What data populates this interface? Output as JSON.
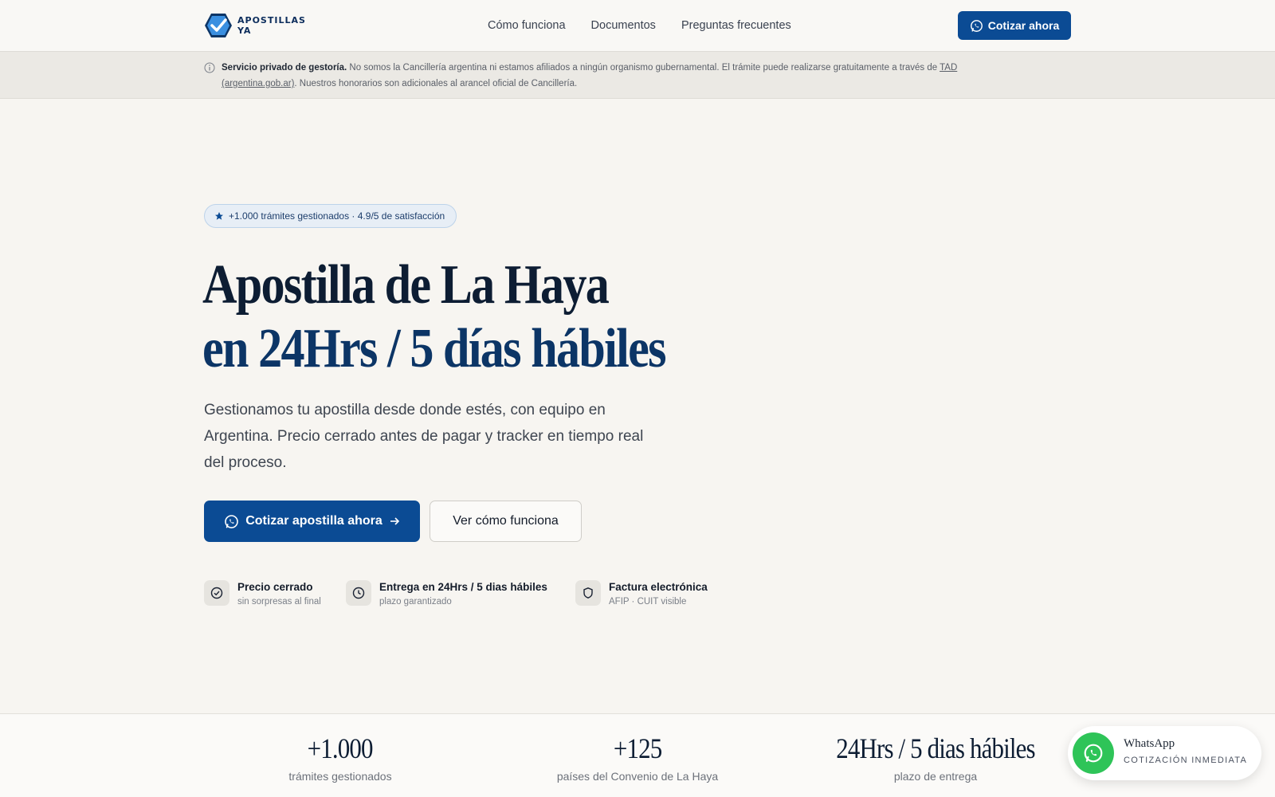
{
  "brand": {
    "line1": "APOSTILLAS",
    "line2": "YA"
  },
  "nav": {
    "links": [
      "Cómo funciona",
      "Documentos",
      "Preguntas frecuentes"
    ],
    "cta": "Cotizar ahora"
  },
  "disclaimer": {
    "bold": "Servicio privado de gestoría.",
    "text1": " No somos la Cancillería argentina ni estamos afiliados a ningún organismo gubernamental. El trámite puede realizarse gratuitamente a través de ",
    "link": "TAD (argentina.gob.ar)",
    "text2": ". Nuestros honorarios son adicionales al arancel oficial de Cancillería."
  },
  "hero": {
    "badge": "+1.000 trámites gestionados · 4.9/5 de satisfacción",
    "title_line1": "Apostilla de La Haya",
    "title_line2": "en 24Hrs / 5 días hábiles",
    "subtitle": "Gestionamos tu apostilla desde donde estés, con equipo en Argentina. Precio cerrado antes de pagar y tracker en tiempo real del proceso.",
    "primary_cta": "Cotizar apostilla ahora",
    "secondary_cta": "Ver cómo funciona"
  },
  "features": [
    {
      "icon": "check-circle-icon",
      "title": "Precio cerrado",
      "sub": "sin sorpresas al final"
    },
    {
      "icon": "clock-icon",
      "title": "Entrega en 24Hrs / 5 dias hábiles",
      "sub": "plazo garantizado"
    },
    {
      "icon": "shield-icon",
      "title": "Factura electrónica",
      "sub": "AFIP · CUIT visible"
    }
  ],
  "stats": [
    {
      "value": "+1.000",
      "label": "trámites gestionados"
    },
    {
      "value": "+125",
      "label": "países del Convenio de La Haya"
    },
    {
      "value": "24Hrs / 5 dias hábiles",
      "label": "plazo de entrega"
    }
  ],
  "whatsapp": {
    "name": "WhatsApp",
    "sub": "COTIZACIÓN INMEDIATA"
  },
  "colors": {
    "primary": "#0b4b94",
    "whatsapp": "#2ec458",
    "background": "#f7f5f1"
  }
}
